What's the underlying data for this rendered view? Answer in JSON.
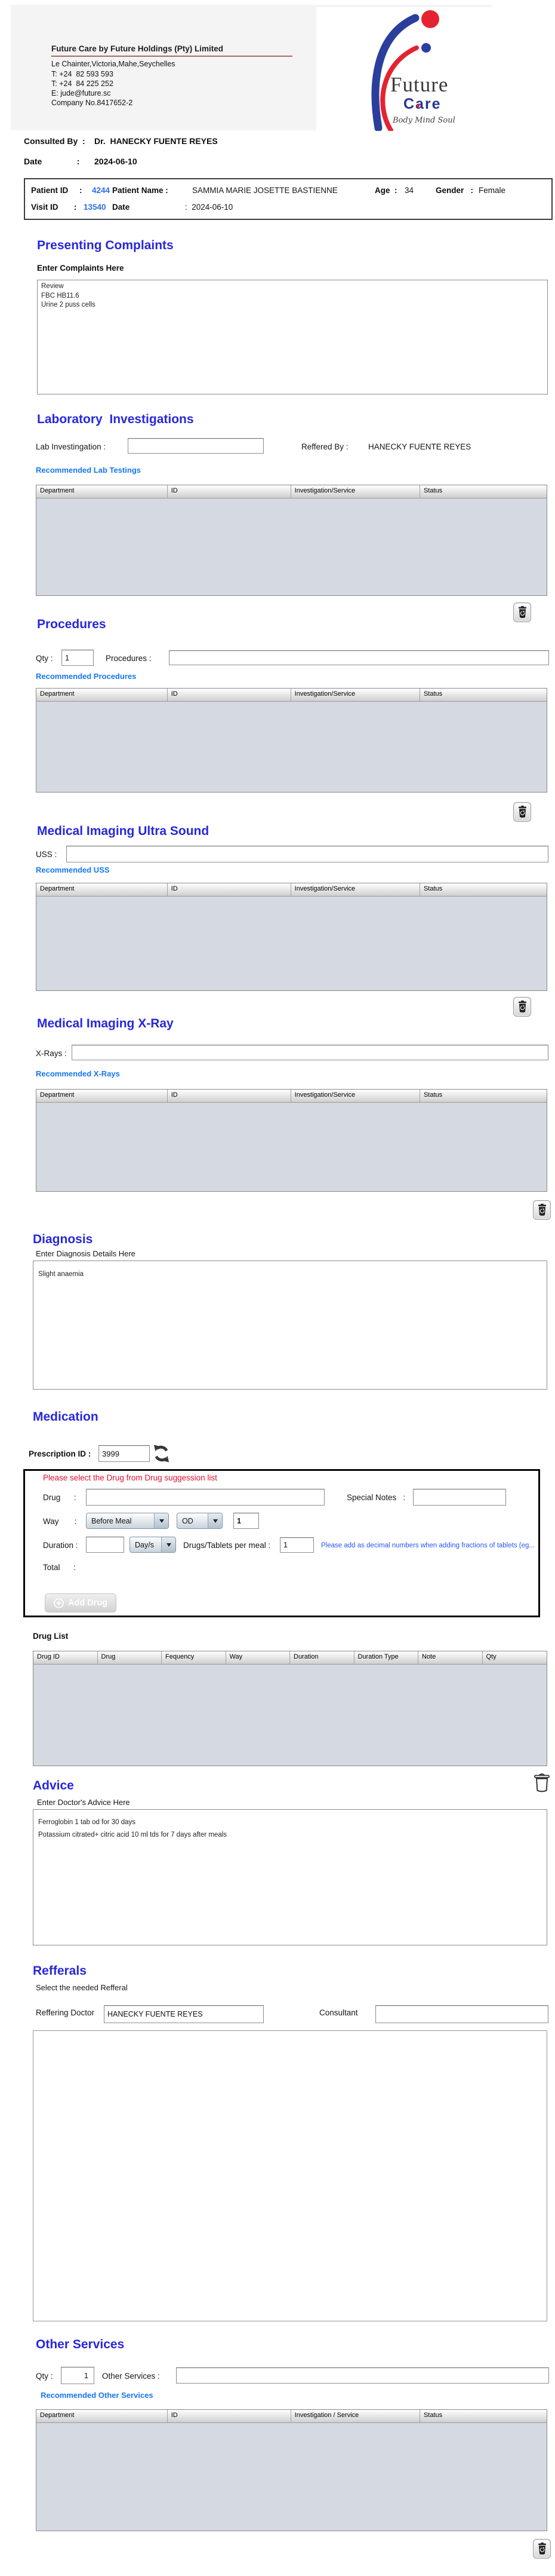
{
  "letterhead": {
    "company": "Future Care by Future Holdings (Pty) Limited",
    "address": [
      "Le Chainter,Victoria,Mahe,Seychelles",
      "T: +24  82 593 593",
      "T: +24  84 225 252",
      "E: jude@future.sc",
      "Company No.8417652-2"
    ],
    "logo": {
      "word1": "Future",
      "word2": "Care",
      "tagline": "Body Mind Soul"
    }
  },
  "consult": {
    "consulted_label": "Consulted By  :",
    "consulted_value": "Dr.  HANECKY FUENTE REYES",
    "date_label": "Date               :",
    "date_value": "2024-06-10"
  },
  "patient": {
    "id_label": "Patient ID     :",
    "id": "4244",
    "name_label": "Patient Name :",
    "name": "SAMMIA MARIE JOSETTE BASTIENNE",
    "age_label": "Age  :",
    "age": "34",
    "gender_label": "Gender   :",
    "gender": "Female",
    "visit_label": "Visit ID       :",
    "visit": "13540",
    "date_label": "Date",
    "date_value": ":  2024-06-10"
  },
  "complaints": {
    "heading": "Presenting Complaints",
    "label": "Enter Complaints Here",
    "value": "Review\nFBC HB11.6\nUrine 2 puss cells"
  },
  "lab": {
    "heading": "Laboratory  Investigations",
    "input_label": "Lab Investingation :",
    "input_value": "",
    "referred_label": "Reffered By :",
    "referred_value": "HANECKY FUENTE REYES",
    "link": "Recommended Lab Testings",
    "headers": [
      "Department",
      "ID",
      "Investigation/Service",
      "Status"
    ]
  },
  "procedures": {
    "heading": "Procedures",
    "qty_label": "Qty :",
    "qty_value": "1",
    "input_label": "Procedures :",
    "input_value": "",
    "link": "Recommended Procedures",
    "headers": [
      "Department",
      "ID",
      "Investigation/Service",
      "Status"
    ]
  },
  "uss": {
    "heading": "Medical Imaging Ultra Sound",
    "input_label": "USS :",
    "input_value": "",
    "link": "Recommended USS",
    "headers": [
      "Department",
      "ID",
      "Investigation/Service",
      "Status"
    ]
  },
  "xray": {
    "heading": "Medical Imaging X-Ray",
    "input_label": "X-Rays :",
    "input_value": "",
    "link": "Recommended X-Rays",
    "headers": [
      "Department",
      "ID",
      "Investigation/Service",
      "Status"
    ]
  },
  "diagnosis": {
    "heading": "Diagnosis",
    "label": "Enter Diagnosis Details Here",
    "value": "Slight anaemia"
  },
  "medication": {
    "heading": "Medication",
    "prescription_label": "Prescription ID :",
    "prescription_id": "3999",
    "warning": "Please select the Drug from Drug suggession list",
    "drug_label": "Drug      :",
    "drug_value": "",
    "special_label": "Special Notes   :",
    "special_value": "",
    "way_label": "Way       :",
    "way_meal": "Before Meal",
    "way_freq": "OD",
    "way_qty": "1",
    "duration_label": "Duration :",
    "duration_value": "",
    "duration_unit": "Day/s",
    "per_meal_label": "Drugs/Tablets per meal :",
    "per_meal_value": "1",
    "fraction_note": "Please add as decimal numbers when adding fractions of tablets (eg...",
    "total_label": "Total      :",
    "add_drug_label": "Add Drug",
    "drug_list_label": "Drug List",
    "drug_headers": [
      "Drug ID",
      "Drug",
      "Fequency",
      "Way",
      "Duration",
      "Duration Type",
      "Note",
      "Qty"
    ]
  },
  "advice": {
    "heading": "Advice",
    "label": "Enter Doctor's Advice Here",
    "value": "Ferroglobin 1 tab od for 30 days\nPotassium citrated+ citric acid 10 ml tds for 7 days after meals"
  },
  "referrals": {
    "heading": "Refferals",
    "label": "Select the needed Refferal",
    "doctor_label": "Reffering Doctor",
    "doctor_value": "HANECKY FUENTE REYES",
    "consultant_label": "Consultant",
    "consultant_value": ""
  },
  "other": {
    "heading": "Other Services",
    "qty_label": "Qty :",
    "qty_value": "1",
    "input_label": "Other Services :",
    "input_value": "",
    "link": "Recommended Other Services",
    "headers": [
      "Department",
      "ID",
      "Investigation / Service",
      "Status"
    ]
  }
}
